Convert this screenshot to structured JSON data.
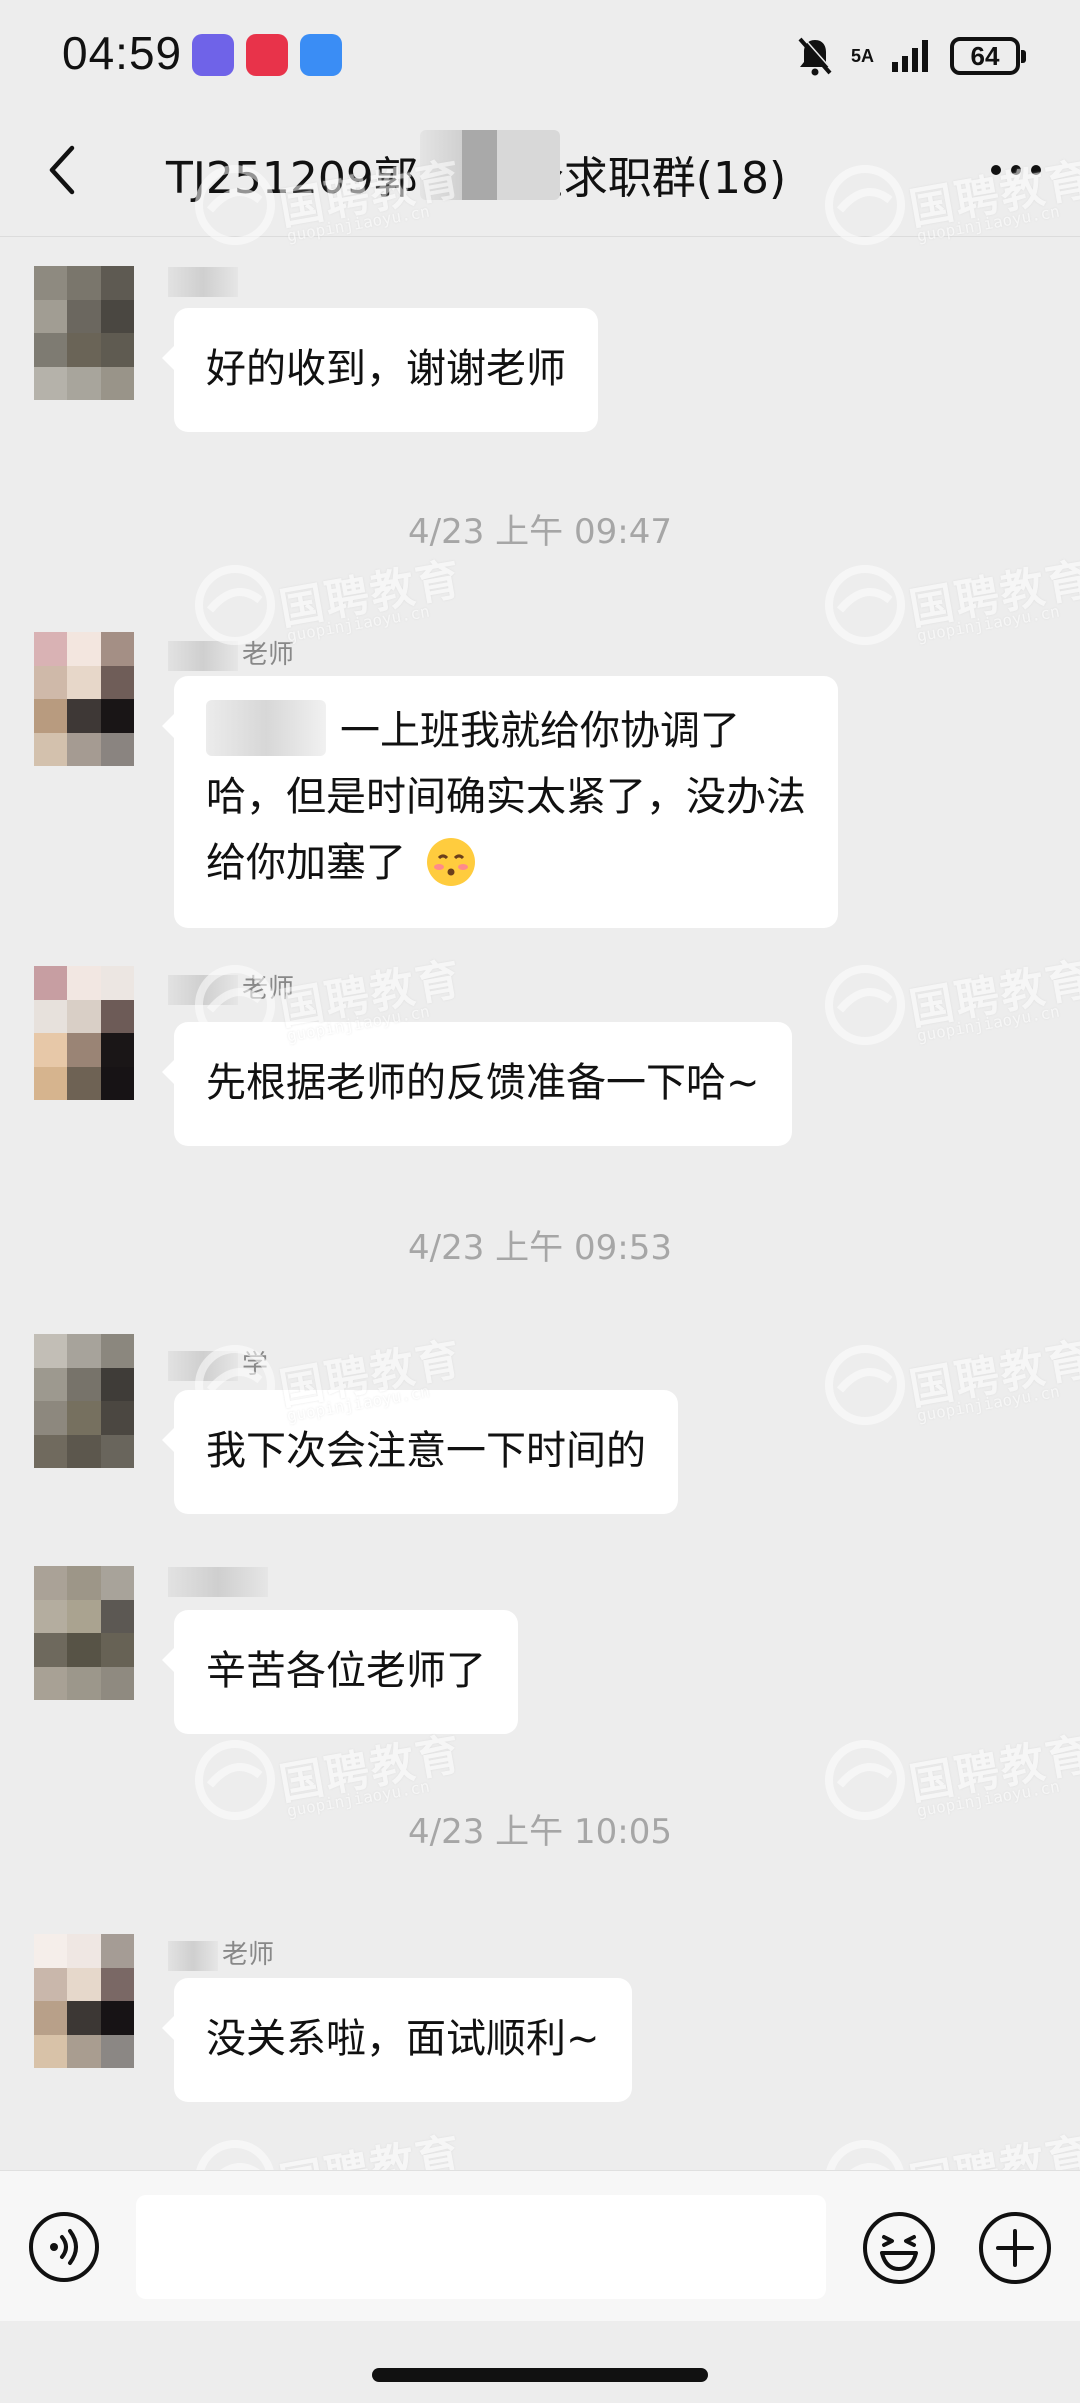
{
  "status": {
    "time": "04:59",
    "network": "5A",
    "battery": "64"
  },
  "nav": {
    "title": "TJ251209郭  学国企求职群(18)"
  },
  "messages": [
    {
      "text": "好的收到，谢谢老师",
      "sender": ""
    },
    {
      "text": "一上班我就给你协调了哈，但是时间确实太紧了，没办法给你加塞了",
      "sender": "老师"
    },
    {
      "text": "先根据老师的反馈准备一下哈~",
      "sender": "老师"
    },
    {
      "text": "我下次会注意一下时间的",
      "sender": "学"
    },
    {
      "text": "辛苦各位老师了",
      "sender": ""
    },
    {
      "text": "没关系啦，面试顺利~",
      "sender": "老师"
    }
  ],
  "timestamps": [
    "4/23 上午 09:47",
    "4/23 上午 09:53",
    "4/23 上午 10:05"
  ],
  "watermark": {
    "text": "国聘教育",
    "sub": "guopinjiaoyu.cn"
  },
  "icons": {
    "back": "chevron-left-icon",
    "more": "ellipsis-icon",
    "voice": "voice-icon",
    "emoji": "emoji-icon",
    "plus": "plus-icon"
  }
}
